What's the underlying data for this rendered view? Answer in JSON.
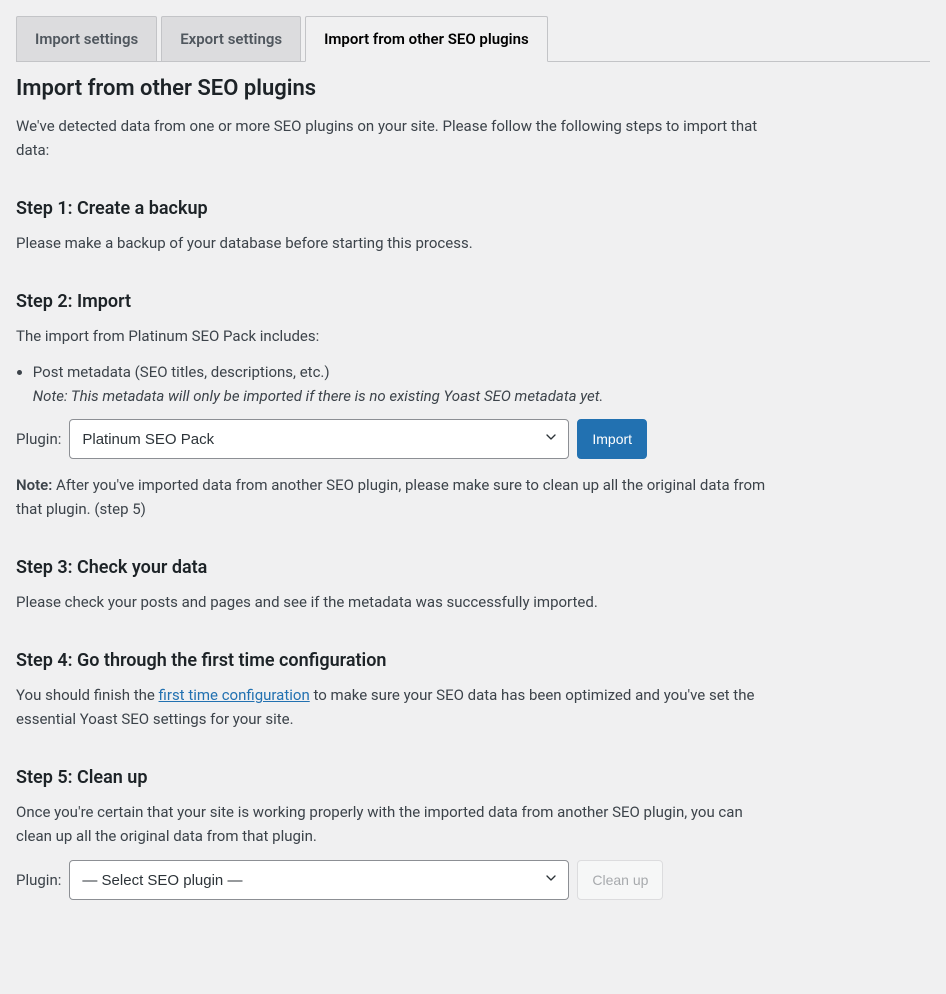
{
  "tabs": [
    {
      "label": "Import settings",
      "active": false
    },
    {
      "label": "Export settings",
      "active": false
    },
    {
      "label": "Import from other SEO plugins",
      "active": true
    }
  ],
  "heading": "Import from other SEO plugins",
  "intro": "We've detected data from one or more SEO plugins on your site. Please follow the following steps to import that data:",
  "step1": {
    "heading": "Step 1: Create a backup",
    "text": "Please make a backup of your database before starting this process."
  },
  "step2": {
    "heading": "Step 2: Import",
    "intro": "The import from Platinum SEO Pack includes:",
    "list_item": "Post metadata (SEO titles, descriptions, etc.)",
    "list_note": "Note: This metadata will only be imported if there is no existing Yoast SEO metadata yet.",
    "plugin_label": "Plugin:",
    "plugin_selected": "Platinum SEO Pack",
    "import_button": "Import",
    "note_label": "Note:",
    "note_text": " After you've imported data from another SEO plugin, please make sure to clean up all the original data from that plugin. (step 5)"
  },
  "step3": {
    "heading": "Step 3: Check your data",
    "text": "Please check your posts and pages and see if the metadata was successfully imported."
  },
  "step4": {
    "heading": "Step 4: Go through the first time configuration",
    "text_before": "You should finish the ",
    "link_text": "first time configuration",
    "text_after": " to make sure your SEO data has been optimized and you've set the essential Yoast SEO settings for your site."
  },
  "step5": {
    "heading": "Step 5: Clean up",
    "text": "Once you're certain that your site is working properly with the imported data from another SEO plugin, you can clean up all the original data from that plugin.",
    "plugin_label": "Plugin:",
    "plugin_selected": "— Select SEO plugin —",
    "cleanup_button": "Clean up"
  }
}
